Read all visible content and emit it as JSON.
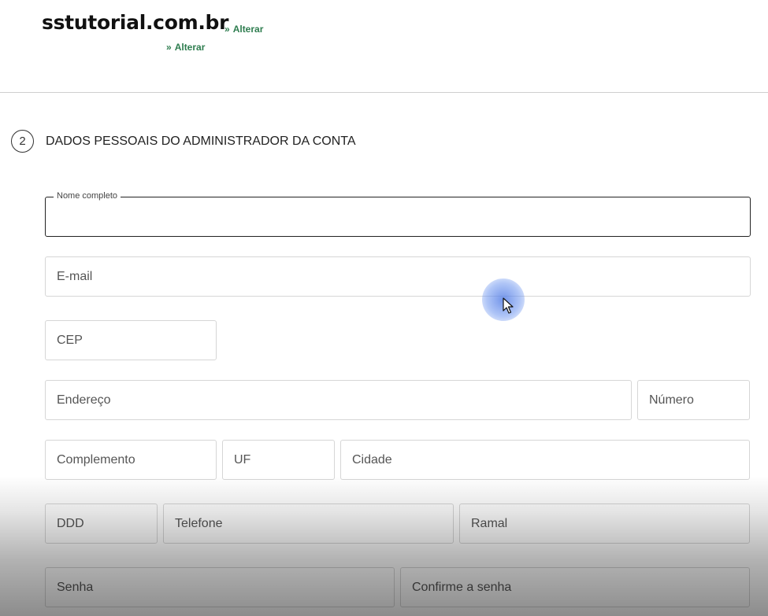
{
  "header": {
    "domain": "sstutorial.com.br",
    "change_link_1": "Alterar",
    "change_link_2": "Alterar",
    "link_prefix": "»",
    "link_color": "#2e7d4f"
  },
  "section": {
    "step": "2",
    "title": "DADOS PESSOAIS DO ADMINISTRADOR DA CONTA"
  },
  "form": {
    "nome_completo": {
      "label": "Nome completo",
      "value": ""
    },
    "email": {
      "placeholder": "E-mail"
    },
    "cep": {
      "placeholder": "CEP"
    },
    "endereco": {
      "placeholder": "Endereço"
    },
    "numero": {
      "placeholder": "Número"
    },
    "complemento": {
      "placeholder": "Complemento"
    },
    "uf": {
      "placeholder": "UF"
    },
    "cidade": {
      "placeholder": "Cidade"
    },
    "ddd": {
      "placeholder": "DDD"
    },
    "telefone": {
      "placeholder": "Telefone"
    },
    "ramal": {
      "placeholder": "Ramal"
    },
    "senha": {
      "placeholder": "Senha"
    },
    "confirme_senha": {
      "placeholder": "Confirme a senha"
    }
  },
  "icons": {
    "cursor": "mouse-pointer-icon"
  }
}
